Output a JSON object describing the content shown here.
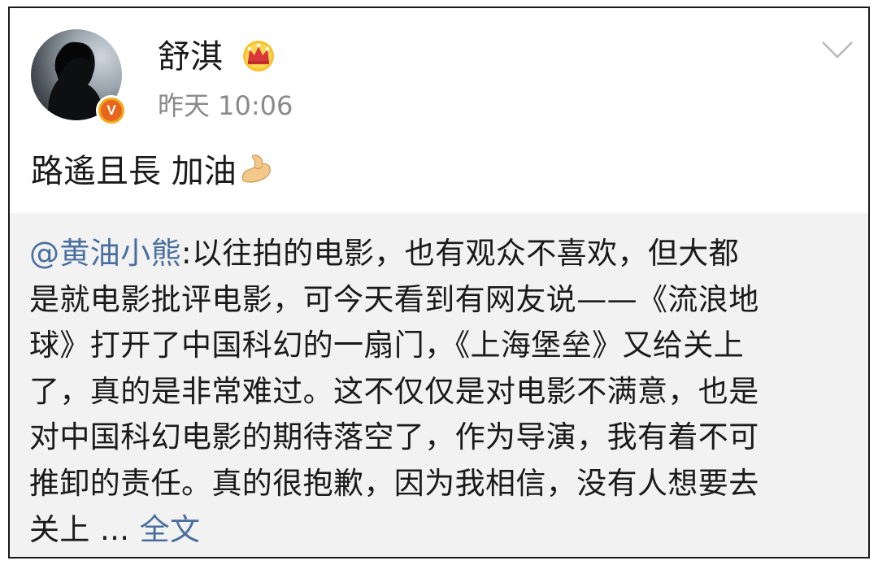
{
  "post": {
    "username": "舒淇",
    "timestamp": "昨天 10:06",
    "text": "路遙且長 加油",
    "emoji": "flexed-biceps-emoji",
    "vip_icon": "crown-icon",
    "verified_badge": "V"
  },
  "repost": {
    "mention": "@黄油小熊",
    "lines": [
      ":以往拍的电影，也有观众不喜欢，但大都",
      "是就电影批评电影，可今天看到有网友说——《流浪地",
      "球》打开了中国科幻的一扇门，《上海堡垒》又给关上",
      "了，真的是非常难过。这不仅仅是对电影不满意，也是",
      "对中国科幻电影的期待落空了，作为导演，我有着不可",
      "推卸的责任。真的很抱歉，因为我相信，没有人想要去"
    ],
    "last_line_prefix": "关上 ... ",
    "full_text_link": "全文"
  },
  "colors": {
    "link": "#4a6f9e",
    "repost_bg": "#f2f2f2",
    "timestamp": "#8a8a8a"
  }
}
